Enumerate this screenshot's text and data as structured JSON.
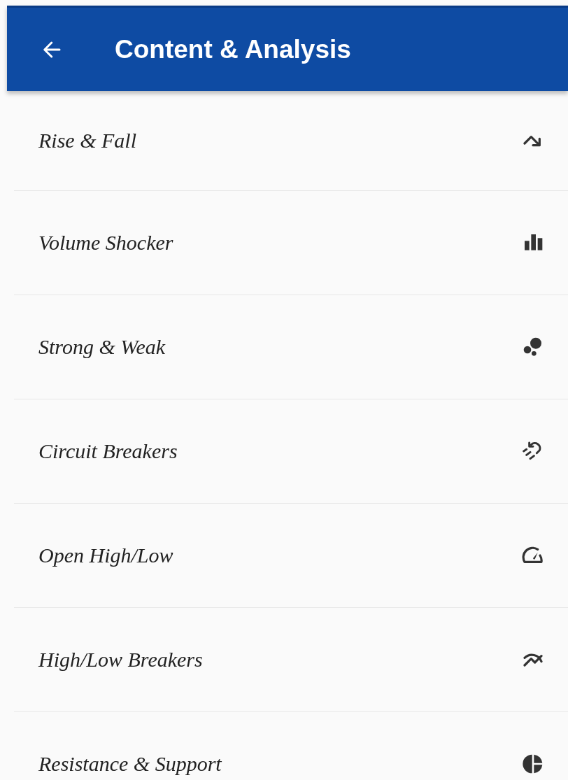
{
  "app_bar": {
    "title": "Content & Analysis"
  },
  "items": [
    {
      "label": "Rise & Fall",
      "kind": "trend-down"
    },
    {
      "label": "Volume Shocker",
      "kind": "bars"
    },
    {
      "label": "Strong & Weak",
      "kind": "bubbles"
    },
    {
      "label": "Circuit Breakers",
      "kind": "magnet"
    },
    {
      "label": "Open High/Low",
      "kind": "gauge"
    },
    {
      "label": "High/Low Breakers",
      "kind": "cross-lines"
    },
    {
      "label": "Resistance & Support",
      "kind": "pie"
    }
  ]
}
